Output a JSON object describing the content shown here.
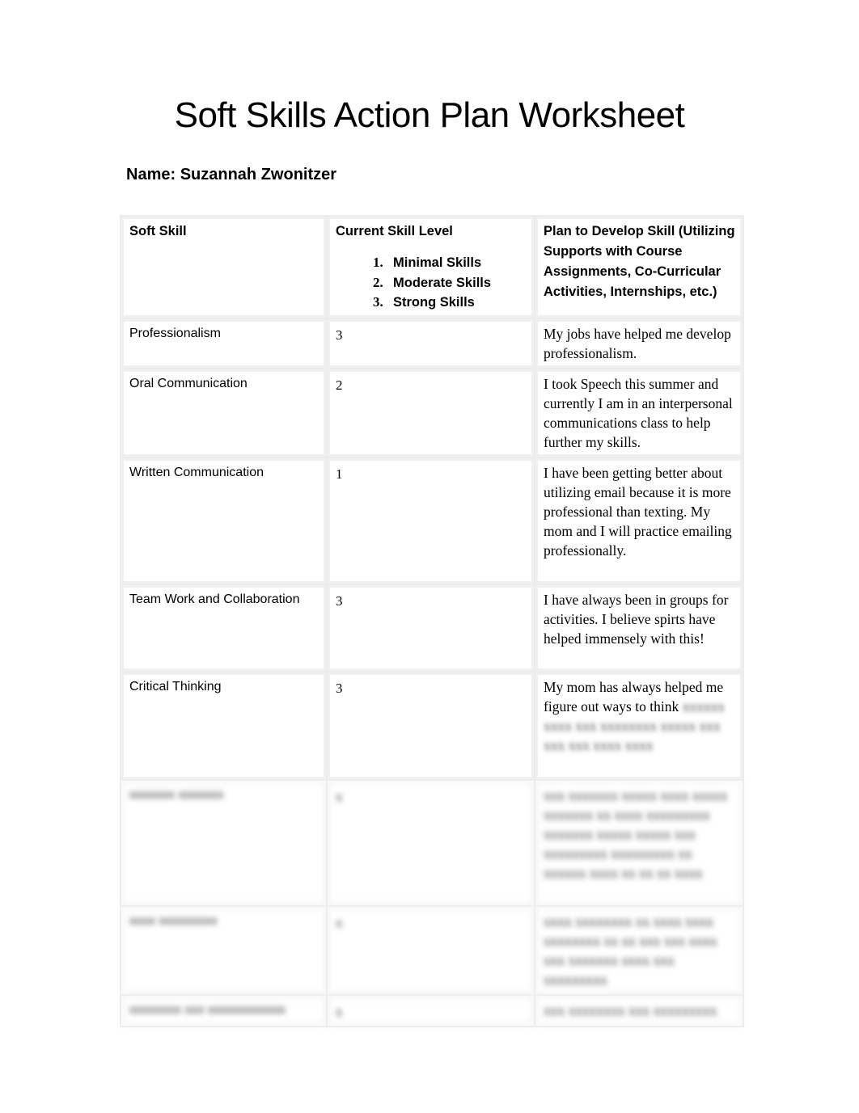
{
  "document": {
    "title": "Soft Skills Action Plan Worksheet",
    "name_label": "Name: Suzannah Zwonitzer"
  },
  "table": {
    "headers": {
      "soft_skill": "Soft Skill",
      "current_level": "Current Skill Level",
      "plan": "Plan to Develop Skill (Utilizing Supports with Course Assignments, Co-Curricular Activities, Internships, etc.)"
    },
    "level_scale": [
      {
        "number": "1.",
        "label": "Minimal Skills"
      },
      {
        "number": "2.",
        "label": "Moderate Skills"
      },
      {
        "number": "3.",
        "label": "Strong Skills"
      }
    ],
    "rows": [
      {
        "skill": "Professionalism",
        "level": "3",
        "plan": "My jobs have helped me develop professionalism."
      },
      {
        "skill": "Oral Communication",
        "level": "2",
        "plan": "I took Speech this summer and currently I am in an interpersonal communications class to help further my skills."
      },
      {
        "skill": "Written Communication",
        "level": "1",
        "plan": "I have been getting better about utilizing email because it is more professional than texting. My mom and I will practice emailing professionally."
      },
      {
        "skill": "Team Work and Collaboration",
        "level": "3",
        "plan": "I have always been in groups for activities. I believe spirts have helped immensely with this!"
      },
      {
        "skill": "Critical Thinking",
        "level": "3",
        "plan_visible": "My mom has always helped me figure out ways to think",
        "plan_blurred": "xxxxxx xxxx xxx xxxxxxxx xxxxx xxx xxx xxx xxxx xxxx"
      }
    ],
    "blurred_rows": [
      {
        "skill": "xxxxxxx xxxxxxx",
        "level": "x",
        "plan": "xxx xxxxxxx xxxxx xxxx xxxxx xxxxxxx xx xxxx xxxxxxxxx xxxxxxx xxxxx xxxxx xxx xxxxxxxxx xxxxxxxxx xx xxxxxx xxxx xx xx xx xxxx"
      },
      {
        "skill": "xxxx xxxxxxxxx",
        "level": "x",
        "plan": "xxxx xxxxxxxx xx xxxx xxxx xxxxxxxx xx xx xxx xxx xxxx xxx xxxxxxx xxxx xxx xxxxxxxxx"
      },
      {
        "skill": "xxxxxxxx xxx xxxxxxxxxxxx",
        "level": "x",
        "plan": "xxx xxxxxxxx xxx xxxxxxxxx"
      }
    ]
  }
}
